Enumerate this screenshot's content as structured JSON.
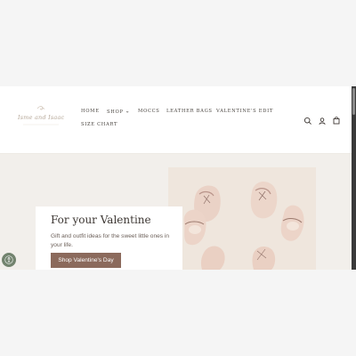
{
  "brand": {
    "logo_text": "Isme and Isaac"
  },
  "nav": {
    "home": "HOME",
    "shop": "SHOP",
    "moccs": "MOCCS",
    "leather_bags": "LEATHER BAGS",
    "valentines_edit": "VALENTINE'S EDIT",
    "size_chart": "SIZE CHART"
  },
  "header_icons": [
    "search-icon",
    "account-icon",
    "bag-icon"
  ],
  "hero": {
    "title": "For your Valentine",
    "description": "Gift and outfit ideas for the sweet little ones in your life.",
    "cta_label": "Shop Valentine's Day"
  },
  "colors": {
    "accent": "#8b6a5c",
    "hero_background": "#f2efeb",
    "accessibility_button": "#72836e"
  }
}
